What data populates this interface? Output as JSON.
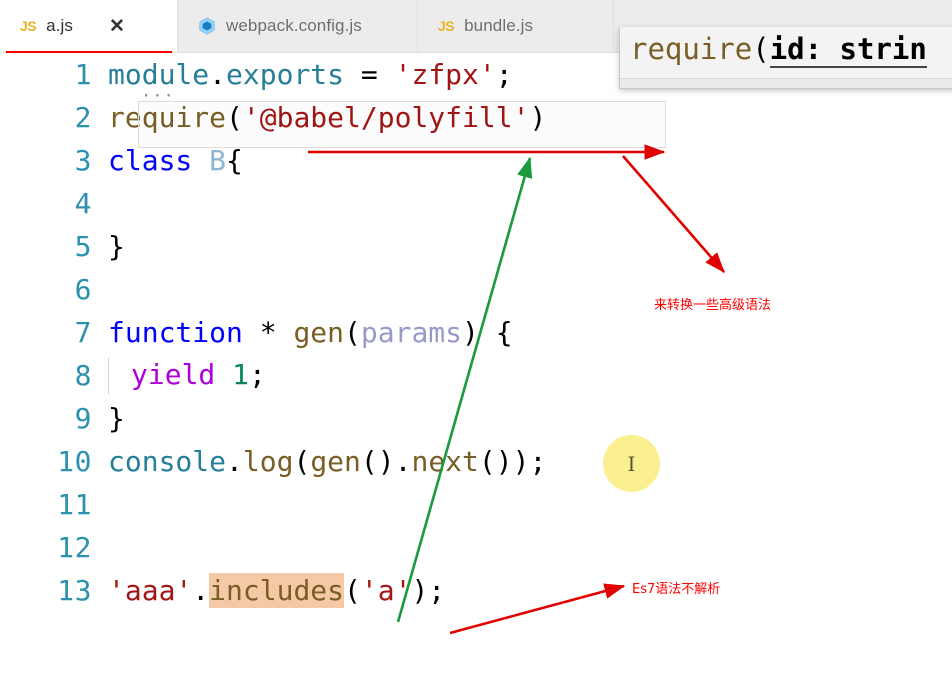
{
  "window": {
    "app": "code-editor",
    "theme": "light"
  },
  "tabs": [
    {
      "label": "a.js",
      "icon": "js-file-icon",
      "active": true,
      "closable": true
    },
    {
      "label": "webpack.config.js",
      "icon": "webpack-hexagon-icon",
      "active": false,
      "closable": false
    },
    {
      "label": "bundle.js",
      "icon": "js-file-icon",
      "active": false,
      "closable": false
    }
  ],
  "tab_close_glyph": "✕",
  "js_icon_text": "JS",
  "tooltip": {
    "name": "signature-help-popup",
    "fn": "require",
    "open_paren": "(",
    "param": "id: strin",
    "full_text": "require(id: strin"
  },
  "editor": {
    "lines": [
      {
        "n": "1",
        "text": "module.exports = 'zfpx';"
      },
      {
        "n": "2",
        "text": "require('@babel/polyfill')"
      },
      {
        "n": "3",
        "text": "class B{"
      },
      {
        "n": "4",
        "text": ""
      },
      {
        "n": "5",
        "text": "}"
      },
      {
        "n": "6",
        "text": ""
      },
      {
        "n": "7",
        "text": "function * gen(params) {"
      },
      {
        "n": "8",
        "text": "  yield 1;"
      },
      {
        "n": "9",
        "text": "}"
      },
      {
        "n": "10",
        "text": "console.log(gen().next());"
      },
      {
        "n": "11",
        "text": ""
      },
      {
        "n": "12",
        "text": ""
      },
      {
        "n": "13",
        "text": "'aaa'.includes('a');"
      }
    ],
    "tokens": {
      "l1_var": "module",
      "l1_dot": ".",
      "l1_prop": "exports",
      "l1_eq": " = ",
      "l1_str": "'zfpx'",
      "l1_semi": ";",
      "l2_fn": "require",
      "l2_open": "(",
      "l2_str": "'@babel/polyfill'",
      "l2_close": ")",
      "l3_kw": "class",
      "l3_name": " B",
      "l3_brace": "{",
      "l5_brace": "}",
      "l7_kw": "function",
      "l7_star": " * ",
      "l7_fn": "gen",
      "l7_open": "(",
      "l7_param": "params",
      "l7_close": ")",
      "l7_brace": " {",
      "l8_kw": "yield",
      "l8_num": " 1",
      "l8_semi": ";",
      "l9_brace": "}",
      "l10_var": "console",
      "l10_dot1": ".",
      "l10_prop1": "log",
      "l10_open1": "(",
      "l10_fn": "gen",
      "l10_call": "()",
      "l10_dot2": ".",
      "l10_prop2": "next",
      "l10_call2": "()",
      "l10_close": ");",
      "l13_str1": "'aaa'",
      "l13_dot": ".",
      "l13_method": "includes",
      "l13_open": "(",
      "l13_str2": "'a'",
      "l13_close": ");"
    },
    "ellipsis": "···"
  },
  "annotations": [
    {
      "id": "anno-transform-syntax",
      "text": "来转换一些高级语法",
      "color": "#ff0000"
    },
    {
      "id": "anno-es7-not-parsed",
      "text": "Es7语法不解析",
      "color": "#ff0000"
    }
  ],
  "arrows": [
    {
      "id": "arrow-horizontal-red",
      "color": "#e00000"
    },
    {
      "id": "arrow-diagonal-red",
      "color": "#e00000"
    },
    {
      "id": "arrow-green-up",
      "color": "#1a9a3c"
    },
    {
      "id": "arrow-red-to-es7",
      "color": "#e00000"
    }
  ],
  "cursor": {
    "id": "click-indicator",
    "glyph": "⌶",
    "highlight_color": "#fbf08f"
  }
}
